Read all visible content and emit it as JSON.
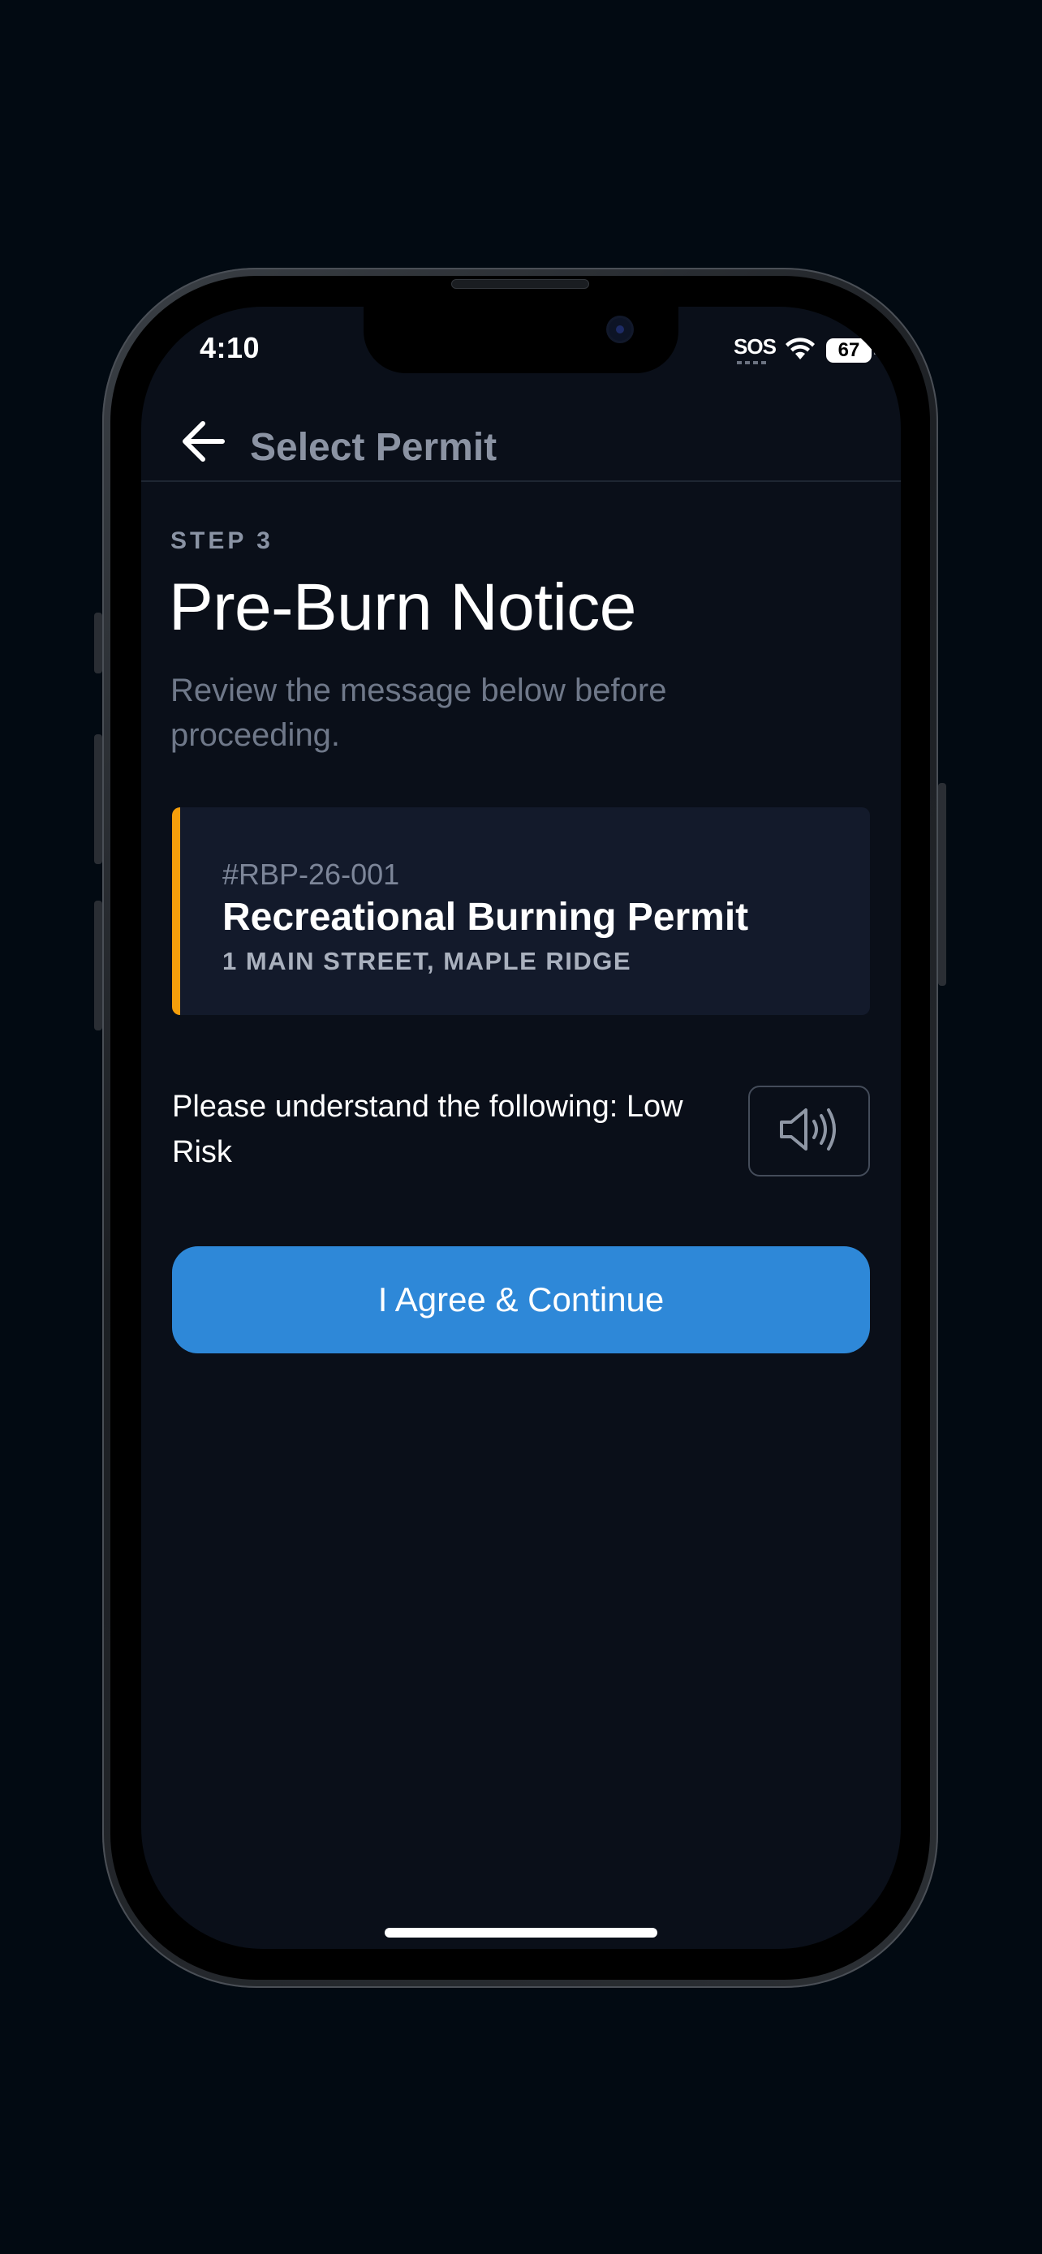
{
  "status_bar": {
    "time": "4:10",
    "carrier": "SOS",
    "battery": "67",
    "icons": [
      "wifi-icon",
      "battery-icon"
    ]
  },
  "header": {
    "back_icon": "arrow-left-icon",
    "title": "Select Permit"
  },
  "main": {
    "step_label": "STEP 3",
    "title": "Pre-Burn Notice",
    "subtitle": "Review the message below before proceeding."
  },
  "permit": {
    "number": "#RBP-26-001",
    "name": "Recreational Burning Permit",
    "address": "1 MAIN STREET, MAPLE RIDGE",
    "accent_color": "#f59e0b"
  },
  "notice": {
    "text": "Please understand the following: Low Risk",
    "audio_icon": "speaker-icon"
  },
  "actions": {
    "agree_label": "I Agree & Continue",
    "agree_color": "#2e88d8"
  }
}
